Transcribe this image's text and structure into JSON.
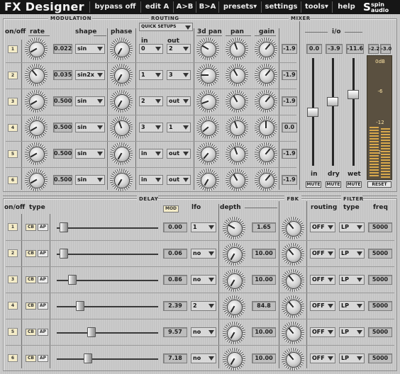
{
  "app": {
    "title": "FX Designer",
    "logo": "spin audio"
  },
  "menu": [
    {
      "label": "bypass off"
    },
    {
      "label": "edit A"
    },
    {
      "label": "A>B"
    },
    {
      "label": "B>A"
    },
    {
      "label": "presets▾"
    },
    {
      "label": "settings"
    },
    {
      "label": "tools▾"
    },
    {
      "label": "help"
    }
  ],
  "modulation": {
    "section": "MODULATION",
    "headers": {
      "onoff": "on/off",
      "rate": "rate",
      "shape": "shape",
      "phase": "phase"
    }
  },
  "routing": {
    "section": "ROUTING",
    "quick": "QUICK SETUPS",
    "in": "in",
    "out": "out"
  },
  "pangain": {
    "pan3d": "3d pan",
    "pan": "pan",
    "gain": "gain"
  },
  "mixer": {
    "section": "MIXER",
    "io": "i/o",
    "values": [
      "0.0",
      "-3.9",
      "-11.6"
    ],
    "meter": [
      "-2.2",
      "-3.0"
    ],
    "scale": [
      "0dB",
      "-6",
      "-12",
      "-24"
    ],
    "labels": [
      "in",
      "dry",
      "wet"
    ],
    "mute": "MUTE",
    "reset": "RESET",
    "levels": [
      0.69,
      0.8,
      0.87
    ]
  },
  "delay": {
    "section": "DELAY",
    "headers": {
      "onoff": "on/off",
      "type": "type",
      "mod": "MOD",
      "lfo": "lfo",
      "depth": "depth"
    },
    "cb": "CB",
    "ap": "AP"
  },
  "fbk": {
    "section": "FBK"
  },
  "filter": {
    "section": "FILTER",
    "routing": "routing",
    "type": "type",
    "freq": "freq"
  },
  "mod_rows": [
    {
      "n": "1",
      "rate": "0.022",
      "shape": "sin",
      "in": "0",
      "out": "2",
      "gain_label": "-1.9"
    },
    {
      "n": "2",
      "rate": "0.035",
      "shape": "sin2x",
      "in": "1",
      "out": "3",
      "gain_label": "-1.9"
    },
    {
      "n": "3",
      "rate": "0.500",
      "shape": "sin",
      "in": "2",
      "out": "out",
      "gain_label": "-1.9"
    },
    {
      "n": "4",
      "rate": "0.500",
      "shape": "sin",
      "in": "3",
      "out": "1",
      "gain_label": "0.0"
    },
    {
      "n": "5",
      "rate": "0.500",
      "shape": "sin",
      "in": "in",
      "out": "out",
      "gain_label": "-1.9"
    },
    {
      "n": "6",
      "rate": "0.500",
      "shape": "sin",
      "in": "in",
      "out": "out",
      "gain_label": "-1.9"
    }
  ],
  "delay_rows": [
    {
      "n": "1",
      "time": "0.00",
      "lfo": "1",
      "depth": "1.65",
      "routing": "OFF",
      "type": "LP",
      "freq": "5000",
      "pos": 0.03
    },
    {
      "n": "2",
      "time": "0.06",
      "lfo": "no",
      "depth": "10.00",
      "routing": "OFF",
      "type": "LP",
      "freq": "5000",
      "pos": 0.03
    },
    {
      "n": "3",
      "time": "0.86",
      "lfo": "no",
      "depth": "10.00",
      "routing": "OFF",
      "type": "LP",
      "freq": "5000",
      "pos": 0.12
    },
    {
      "n": "4",
      "time": "2.39",
      "lfo": "2",
      "depth": "84.8",
      "routing": "OFF",
      "type": "LP",
      "freq": "5000",
      "pos": 0.2
    },
    {
      "n": "5",
      "time": "9.57",
      "lfo": "no",
      "depth": "10.00",
      "routing": "OFF",
      "type": "LP",
      "freq": "5000",
      "pos": 0.32
    },
    {
      "n": "6",
      "time": "7.18",
      "lfo": "no",
      "depth": "10.00",
      "routing": "OFF",
      "type": "LP",
      "freq": "5000",
      "pos": 0.28
    }
  ]
}
